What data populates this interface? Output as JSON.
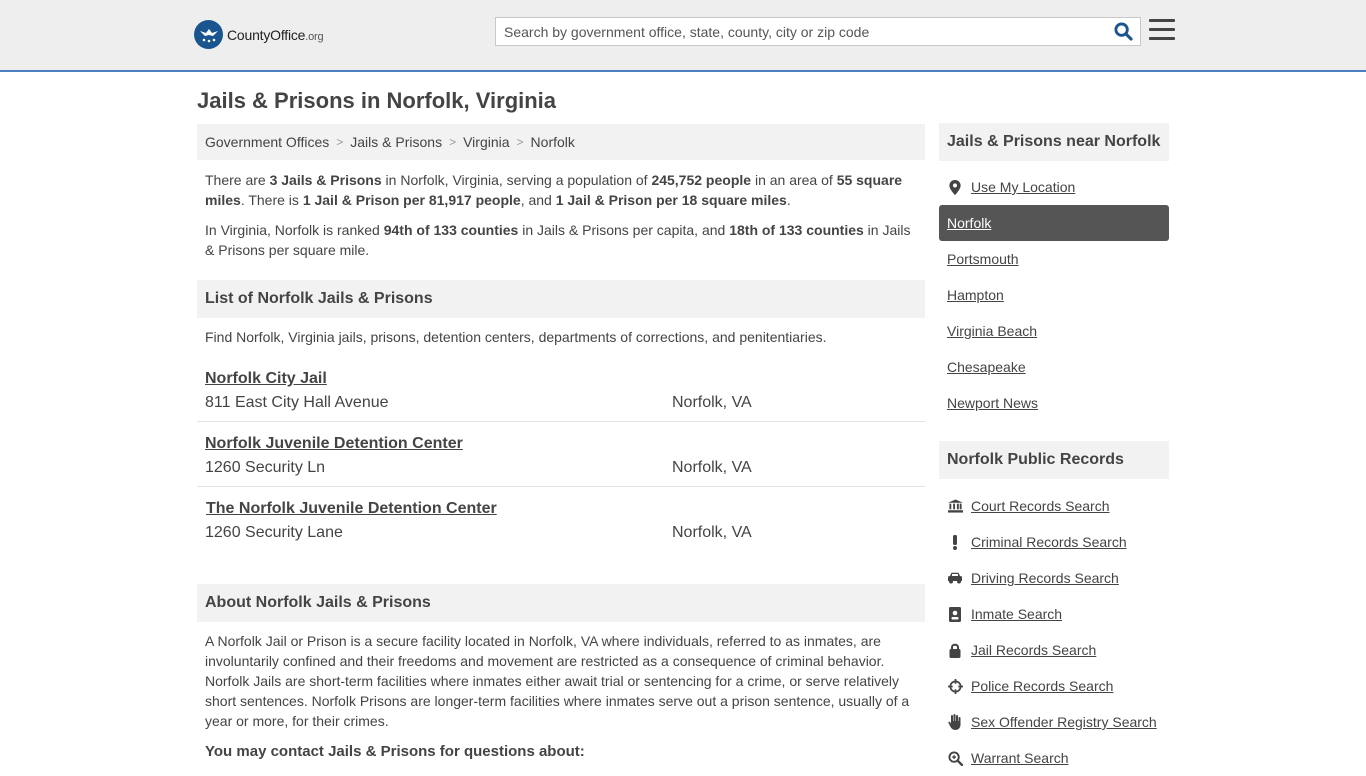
{
  "header": {
    "logo_main": "CountyOffice",
    "logo_suffix": ".org",
    "search_placeholder": "Search by government office, state, county, city or zip code"
  },
  "page_title": "Jails & Prisons in Norfolk, Virginia",
  "breadcrumb": [
    "Government Offices",
    "Jails & Prisons",
    "Virginia",
    "Norfolk"
  ],
  "intro": {
    "p1": {
      "t1": "There are ",
      "b1": "3 Jails & Prisons",
      "t2": " in Norfolk, Virginia, serving a population of ",
      "b2": "245,752 people",
      "t3": " in an area of ",
      "b3": "55 square miles",
      "t4": ". There is ",
      "b4": "1 Jail & Prison per 81,917 people",
      "t5": ", and ",
      "b5": "1 Jail & Prison per 18 square miles",
      "t6": "."
    },
    "p2": {
      "t1": "In Virginia, Norfolk is ranked ",
      "b1": "94th of 133 counties",
      "t2": " in Jails & Prisons per capita, and ",
      "b2": "18th of 133 counties",
      "t3": " in Jails & Prisons per square mile."
    }
  },
  "list_section": {
    "title": "List of Norfolk Jails & Prisons",
    "description": "Find Norfolk, Virginia jails, prisons, detention centers, departments of corrections, and penitentiaries.",
    "listings": [
      {
        "name": "Norfolk City Jail",
        "address": "811 East City Hall Avenue",
        "city": "Norfolk, VA"
      },
      {
        "name": "Norfolk Juvenile Detention Center",
        "address": "1260 Security Ln",
        "city": "Norfolk, VA"
      },
      {
        "name": "The Norfolk Juvenile Detention Center",
        "address": "1260 Security Lane",
        "city": "Norfolk, VA"
      }
    ]
  },
  "about_section": {
    "title": "About Norfolk Jails & Prisons",
    "body": "A Norfolk Jail or Prison is a secure facility located in Norfolk, VA where individuals, referred to as inmates, are involuntarily confined and their freedoms and movement are restricted as a consequence of criminal behavior. Norfolk Jails are short-term facilities where inmates either await trial or sentencing for a crime, or serve relatively short sentences. Norfolk Prisons are longer-term facilities where inmates serve out a prison sentence, usually of a year or more, for their crimes.",
    "contact_heading": "You may contact Jails & Prisons for questions about:"
  },
  "sidebar": {
    "nearby": {
      "title": "Jails & Prisons near Norfolk",
      "use_location": "Use My Location",
      "items": [
        "Norfolk",
        "Portsmouth",
        "Hampton",
        "Virginia Beach",
        "Chesapeake",
        "Newport News"
      ],
      "active": "Norfolk"
    },
    "records": {
      "title": "Norfolk Public Records",
      "items": [
        {
          "label": "Court Records Search",
          "icon": "courthouse-icon"
        },
        {
          "label": "Criminal Records Search",
          "icon": "exclamation-icon"
        },
        {
          "label": "Driving Records Search",
          "icon": "car-icon"
        },
        {
          "label": "Inmate Search",
          "icon": "id-card-icon"
        },
        {
          "label": "Jail Records Search",
          "icon": "lock-icon"
        },
        {
          "label": "Police Records Search",
          "icon": "crosshair-icon"
        },
        {
          "label": "Sex Offender Registry Search",
          "icon": "hand-icon"
        },
        {
          "label": "Warrant Search",
          "icon": "magnifier-icon"
        }
      ]
    }
  },
  "colors": {
    "accent": "#4a7fc1",
    "logo": "#1a5590",
    "active_bg": "#555555",
    "panel_bg": "#f2f2f2"
  }
}
